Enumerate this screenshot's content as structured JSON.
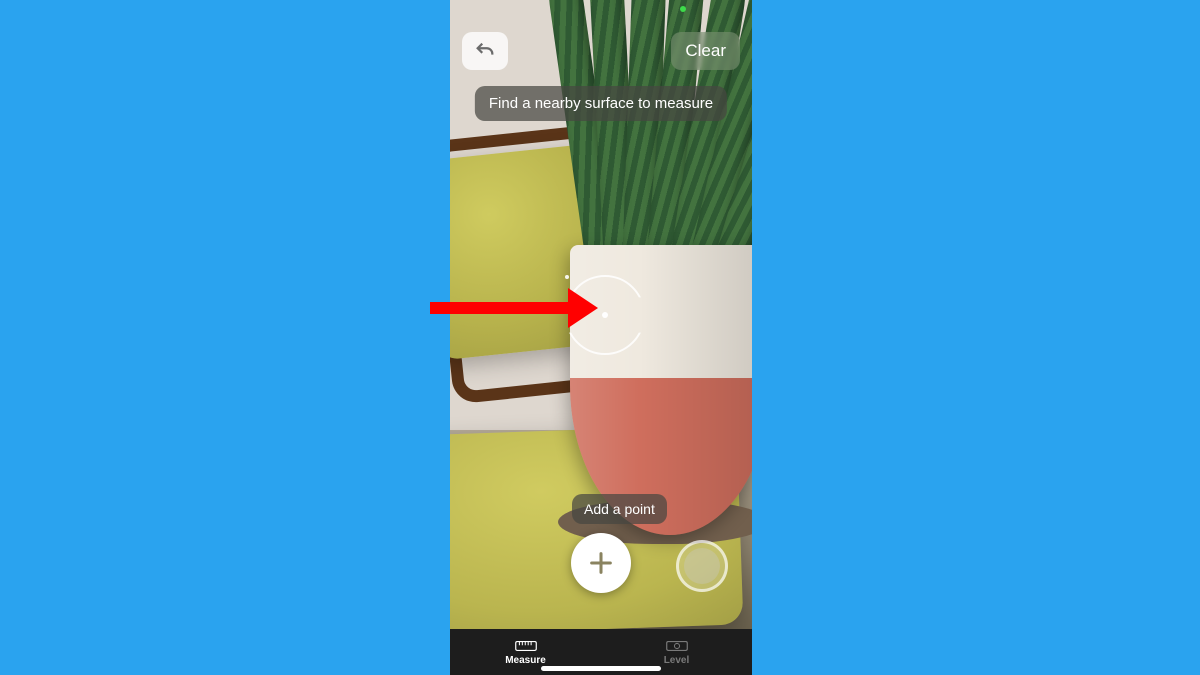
{
  "buttons": {
    "clear_label": "Clear",
    "add_point_hint": "Add a point"
  },
  "hints": {
    "surface": "Find a nearby surface to measure"
  },
  "tabs": {
    "measure": "Measure",
    "level": "Level"
  }
}
